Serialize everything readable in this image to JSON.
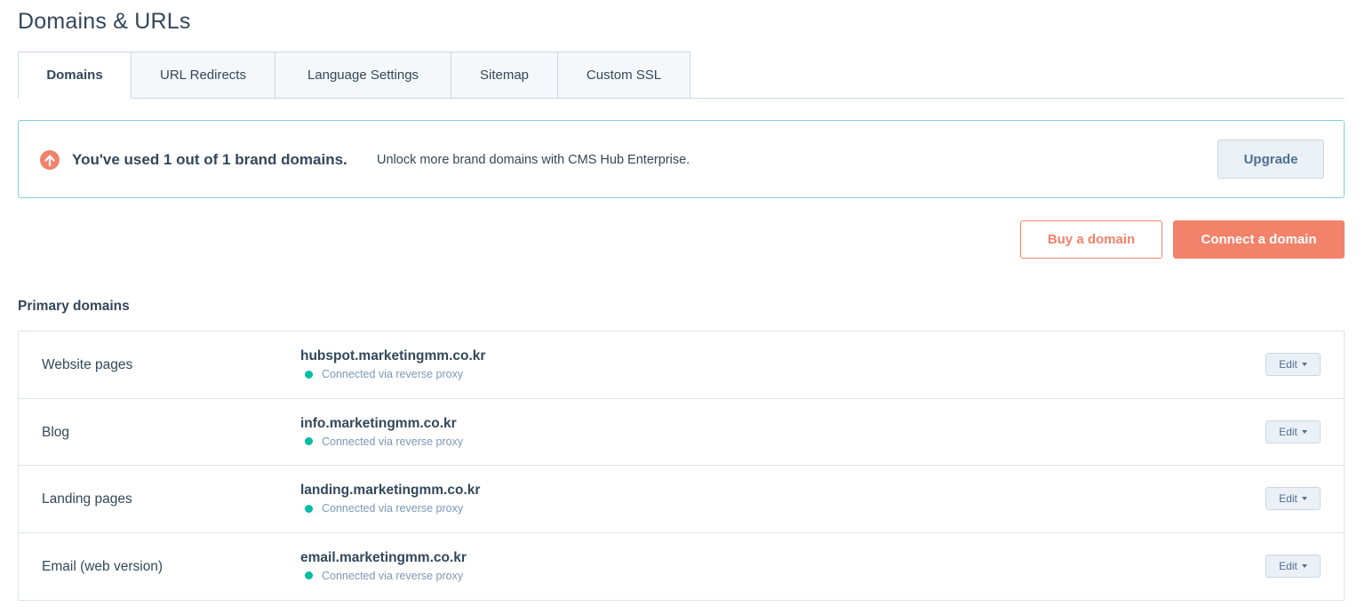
{
  "page": {
    "title": "Domains & URLs"
  },
  "tabs": [
    {
      "label": "Domains",
      "active": true
    },
    {
      "label": "URL Redirects",
      "active": false
    },
    {
      "label": "Language Settings",
      "active": false
    },
    {
      "label": "Sitemap",
      "active": false
    },
    {
      "label": "Custom SSL",
      "active": false
    }
  ],
  "alert": {
    "icon": "arrow-up-circle-icon",
    "strong_text": "You've used 1 out of 1 brand domains.",
    "text": "Unlock more brand domains with CMS Hub Enterprise.",
    "upgrade_label": "Upgrade"
  },
  "actions": {
    "buy_label": "Buy a domain",
    "connect_label": "Connect a domain"
  },
  "primary_domains": {
    "title": "Primary domains",
    "rows": [
      {
        "label": "Website pages",
        "domain": "hubspot.marketingmm.co.kr",
        "status": "Connected via reverse proxy",
        "edit_label": "Edit"
      },
      {
        "label": "Blog",
        "domain": "info.marketingmm.co.kr",
        "status": "Connected via reverse proxy",
        "edit_label": "Edit"
      },
      {
        "label": "Landing pages",
        "domain": "landing.marketingmm.co.kr",
        "status": "Connected via reverse proxy",
        "edit_label": "Edit"
      },
      {
        "label": "Email (web version)",
        "domain": "email.marketingmm.co.kr",
        "status": "Connected via reverse proxy",
        "edit_label": "Edit"
      }
    ]
  },
  "colors": {
    "accent": "#f2826a",
    "status_connected": "#00bda5",
    "alert_border": "#7fd1de",
    "text": "#33475b"
  }
}
